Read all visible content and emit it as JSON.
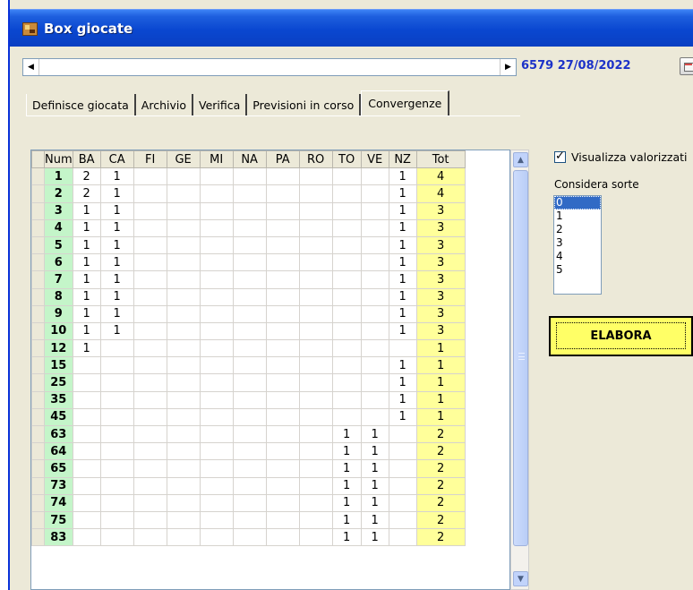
{
  "window": {
    "title": "Box giocate"
  },
  "toolbar": {
    "draw_info": "6579 27/08/2022"
  },
  "tabs": [
    {
      "label": "Definisce giocata"
    },
    {
      "label": "Archivio"
    },
    {
      "label": "Verifica"
    },
    {
      "label": "Previsioni in corso"
    },
    {
      "label": "Convergenze",
      "active": true
    }
  ],
  "grid": {
    "headers": [
      "Num",
      "BA",
      "CA",
      "FI",
      "GE",
      "MI",
      "NA",
      "PA",
      "RO",
      "TO",
      "VE",
      "NZ",
      "Tot"
    ],
    "rows": [
      [
        "1",
        "2",
        "1",
        "",
        "",
        "",
        "",
        "",
        "",
        "",
        "",
        "1",
        "4"
      ],
      [
        "2",
        "2",
        "1",
        "",
        "",
        "",
        "",
        "",
        "",
        "",
        "",
        "1",
        "4"
      ],
      [
        "3",
        "1",
        "1",
        "",
        "",
        "",
        "",
        "",
        "",
        "",
        "",
        "1",
        "3"
      ],
      [
        "4",
        "1",
        "1",
        "",
        "",
        "",
        "",
        "",
        "",
        "",
        "",
        "1",
        "3"
      ],
      [
        "5",
        "1",
        "1",
        "",
        "",
        "",
        "",
        "",
        "",
        "",
        "",
        "1",
        "3"
      ],
      [
        "6",
        "1",
        "1",
        "",
        "",
        "",
        "",
        "",
        "",
        "",
        "",
        "1",
        "3"
      ],
      [
        "7",
        "1",
        "1",
        "",
        "",
        "",
        "",
        "",
        "",
        "",
        "",
        "1",
        "3"
      ],
      [
        "8",
        "1",
        "1",
        "",
        "",
        "",
        "",
        "",
        "",
        "",
        "",
        "1",
        "3"
      ],
      [
        "9",
        "1",
        "1",
        "",
        "",
        "",
        "",
        "",
        "",
        "",
        "",
        "1",
        "3"
      ],
      [
        "10",
        "1",
        "1",
        "",
        "",
        "",
        "",
        "",
        "",
        "",
        "",
        "1",
        "3"
      ],
      [
        "12",
        "1",
        "",
        "",
        "",
        "",
        "",
        "",
        "",
        "",
        "",
        "",
        "1"
      ],
      [
        "15",
        "",
        "",
        "",
        "",
        "",
        "",
        "",
        "",
        "",
        "",
        "1",
        "1"
      ],
      [
        "25",
        "",
        "",
        "",
        "",
        "",
        "",
        "",
        "",
        "",
        "",
        "1",
        "1"
      ],
      [
        "35",
        "",
        "",
        "",
        "",
        "",
        "",
        "",
        "",
        "",
        "",
        "1",
        "1"
      ],
      [
        "45",
        "",
        "",
        "",
        "",
        "",
        "",
        "",
        "",
        "",
        "",
        "1",
        "1"
      ],
      [
        "63",
        "",
        "",
        "",
        "",
        "",
        "",
        "",
        "",
        "1",
        "1",
        "",
        "2"
      ],
      [
        "64",
        "",
        "",
        "",
        "",
        "",
        "",
        "",
        "",
        "1",
        "1",
        "",
        "2"
      ],
      [
        "65",
        "",
        "",
        "",
        "",
        "",
        "",
        "",
        "",
        "1",
        "1",
        "",
        "2"
      ],
      [
        "73",
        "",
        "",
        "",
        "",
        "",
        "",
        "",
        "",
        "1",
        "1",
        "",
        "2"
      ],
      [
        "74",
        "",
        "",
        "",
        "",
        "",
        "",
        "",
        "",
        "1",
        "1",
        "",
        "2"
      ],
      [
        "75",
        "",
        "",
        "",
        "",
        "",
        "",
        "",
        "",
        "1",
        "1",
        "",
        "2"
      ],
      [
        "83",
        "",
        "",
        "",
        "",
        "",
        "",
        "",
        "",
        "1",
        "1",
        "",
        "2"
      ]
    ]
  },
  "options": {
    "show_valued_label": "Visualizza valorizzati",
    "show_valued_checked": true,
    "sorte_label": "Considera sorte",
    "sorte_options": [
      "0",
      "1",
      "2",
      "3",
      "4",
      "5"
    ],
    "sorte_selected": "0"
  },
  "actions": {
    "elabora_label": "ELABORA"
  },
  "colors": {
    "num_col": "#c4f5c9",
    "tot_col": "#ffff9a",
    "draw_info": "#1c32c8",
    "elabora": "#ffff66"
  }
}
